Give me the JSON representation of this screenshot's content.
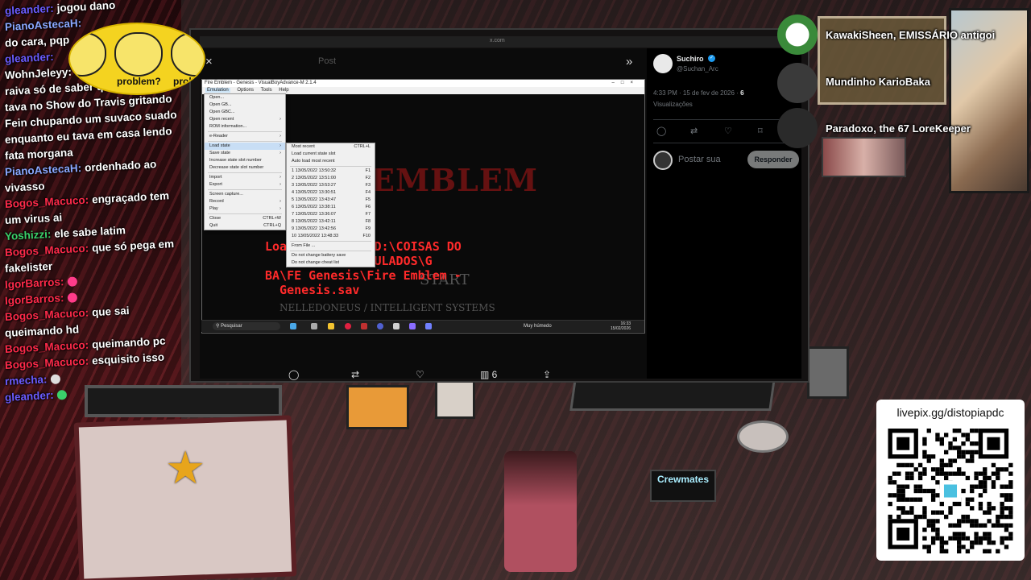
{
  "chat": [
    {
      "user": "gleander:",
      "text": "jogou dano",
      "color": "#6b5cff"
    },
    {
      "user": "PianoAstecaH:",
      "text": "",
      "color": "#8aa8ff"
    },
    {
      "user": "",
      "text": "do cara, pqp",
      "color": "#ffffff"
    },
    {
      "user": "gleander:",
      "text": "",
      "color": "#6b5cff"
    },
    {
      "user": "WohnJeleyy:",
      "text": "",
      "color": "#ffffff"
    },
    {
      "user": "",
      "text": "raiva só de saber que esse cara",
      "color": "#ffffff"
    },
    {
      "user": "",
      "text": "tava no Show do Travis gritando",
      "color": "#ffffff"
    },
    {
      "user": "",
      "text": "Fein chupando um suvaco suado",
      "color": "#ffffff"
    },
    {
      "user": "",
      "text": "enquanto eu tava em casa lendo",
      "color": "#ffffff"
    },
    {
      "user": "",
      "text": "fata morgana",
      "color": "#ffffff"
    },
    {
      "user": "PianoAstecaH:",
      "text": "ordenhado ao",
      "color": "#8aa8ff"
    },
    {
      "user": "",
      "text": "vivasso",
      "color": "#ffffff"
    },
    {
      "user": "Bogos_Macuco:",
      "text": "engraçado tem",
      "color": "#ff2a4a"
    },
    {
      "user": "",
      "text": "um virus ai",
      "color": "#ffffff"
    },
    {
      "user": "Yoshizzi:",
      "text": "ele sabe latim",
      "color": "#3ad16a"
    },
    {
      "user": "Bogos_Macuco:",
      "text": "que só pega em",
      "color": "#ff2a4a"
    },
    {
      "user": "",
      "text": "fakelister",
      "color": "#ffffff"
    },
    {
      "user": "IgorBarros:",
      "text": "",
      "color": "#ff2a4a",
      "emote": "#ff3c8a"
    },
    {
      "user": "IgorBarros:",
      "text": "",
      "color": "#ff2a4a",
      "emote": "#ff3c8a"
    },
    {
      "user": "Bogos_Macuco:",
      "text": "que sai",
      "color": "#ff2a4a"
    },
    {
      "user": "",
      "text": "queimando hd",
      "color": "#ffffff"
    },
    {
      "user": "Bogos_Macuco:",
      "text": "queimando pc",
      "color": "#ff2a4a"
    },
    {
      "user": "Bogos_Macuco:",
      "text": "esquisito isso",
      "color": "#ff2a4a"
    },
    {
      "user": "rmecha:",
      "text": "",
      "color": "#6b5cff",
      "emote": "#dddddd"
    },
    {
      "user": "gleander:",
      "text": "",
      "color": "#6b5cff",
      "emote": "#3ad16a"
    }
  ],
  "troll": {
    "text1": "problem?",
    "text2": "probl"
  },
  "browser": {
    "url": "x.com",
    "post_label": "Post",
    "close": "×",
    "expand": "»"
  },
  "emulator": {
    "title": "Fire Emblem - Genesis - VisualBoyAdvance-M 2.1.4",
    "controls": "–□×",
    "menubar": [
      "Emulation",
      "Options",
      "Tools",
      "Help"
    ],
    "game_title": "EMBLEM",
    "load_text": "Loaded battery D:\\COISAS DO\n   H  \\JOGOS EMULADOS\\G\nBA\\FE Genesis\\Fire Emblem -\n  Genesis.sav",
    "start": "START",
    "credit": "NELLEDONEUS / INTELLIGENT SYSTEMS"
  },
  "menu1": [
    {
      "label": "Open...",
      "sc": ""
    },
    {
      "label": "Open GB...",
      "sc": ""
    },
    {
      "label": "Open GBC...",
      "sc": ""
    },
    {
      "label": "Open recent",
      "sc": "›"
    },
    {
      "label": "ROM information...",
      "sc": ""
    },
    {
      "sep": true
    },
    {
      "label": "e-Reader",
      "sc": "›"
    },
    {
      "sep": true
    },
    {
      "label": "Load state",
      "sc": "›",
      "hl": true
    },
    {
      "label": "Save state",
      "sc": "›"
    },
    {
      "label": "Increase state slot number",
      "sc": ""
    },
    {
      "label": "Decrease state slot number",
      "sc": ""
    },
    {
      "sep": true
    },
    {
      "label": "Import",
      "sc": "›"
    },
    {
      "label": "Export",
      "sc": "›"
    },
    {
      "sep": true
    },
    {
      "label": "Screen capture...",
      "sc": ""
    },
    {
      "label": "Record",
      "sc": "›"
    },
    {
      "label": "Play",
      "sc": "›"
    },
    {
      "sep": true
    },
    {
      "label": "Close",
      "sc": "CTRL+W"
    },
    {
      "label": "Quit",
      "sc": "CTRL+Q"
    }
  ],
  "menu2": [
    {
      "label": "Most recent",
      "sc": "CTRL+L"
    },
    {
      "label": "Load current state slot",
      "sc": ""
    },
    {
      "label": "Auto load most recent",
      "sc": ""
    },
    {
      "sep": true
    },
    {
      "label": "1 13/05/2022 13:50:32",
      "sc": "F1"
    },
    {
      "label": "2 13/05/2022 13:51:00",
      "sc": "F2"
    },
    {
      "label": "3 13/05/2022 13:53:27",
      "sc": "F3"
    },
    {
      "label": "4 13/05/2022 13:30:51",
      "sc": "F4"
    },
    {
      "label": "5 13/05/2022 13:43:47",
      "sc": "F5"
    },
    {
      "label": "6 13/05/2022 13:38:11",
      "sc": "F6"
    },
    {
      "label": "7 13/05/2022 13:36:07",
      "sc": "F7"
    },
    {
      "label": "8 13/05/2022 13:42:11",
      "sc": "F8"
    },
    {
      "label": "9 13/05/2022 13:42:56",
      "sc": "F9"
    },
    {
      "label": "10 13/05/2022 13:48:33",
      "sc": "F10"
    },
    {
      "sep": true
    },
    {
      "label": "From File ...",
      "sc": ""
    },
    {
      "sep": true
    },
    {
      "label": "Do not change battery save",
      "sc": ""
    },
    {
      "label": "Do not change cheat list",
      "sc": ""
    }
  ],
  "taskbar": {
    "search": "Pesquisar",
    "weather": "Muy húmedo",
    "time": "16:33",
    "date": "15/02/2026"
  },
  "tweet": {
    "name": "Suchiro",
    "handle": "@Suchan_Arc",
    "date": "4:33 PM · 15 de fev de 2026 · ",
    "views_count": "6",
    "views_label": "Visualizações",
    "reply_placeholder": "Postar sua",
    "reply_button": "Responder",
    "share_count": "6"
  },
  "supporters": [
    {
      "name": "KawakiSheen, EMISSÁRIO antigoi"
    },
    {
      "name": "Mundinho KarioBaka"
    },
    {
      "name": "Paradoxo, the 67 LoreKeeper"
    }
  ],
  "desk": {
    "crewmates": "Crewmates"
  },
  "qr": {
    "label": "livepix.gg/distopiapdc"
  },
  "colors": {
    "accent": "#1d9bf0",
    "chat_red": "#ff2a4a",
    "chat_blue": "#6b5cff"
  }
}
